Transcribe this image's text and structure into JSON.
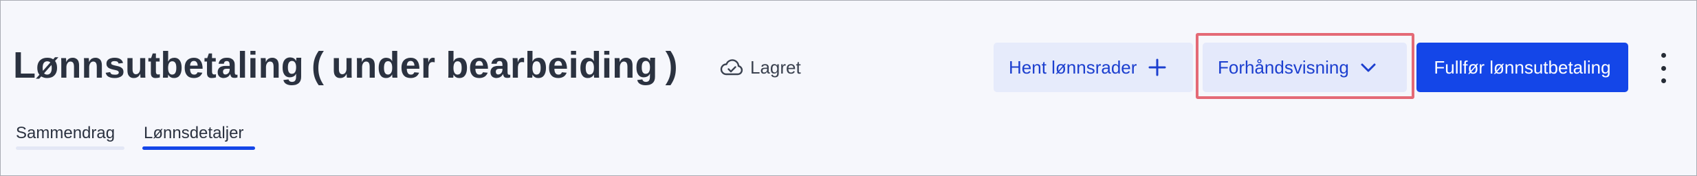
{
  "header": {
    "title": "Lønnsutbetaling ( under bearbeiding )",
    "save_status": "Lagret",
    "save_icon": "cloud-check-icon"
  },
  "actions": {
    "hent_label": "Hent lønnsrader",
    "hent_icon": "plus-icon",
    "preview_label": "Forhåndsvisning",
    "preview_icon": "chevron-down-icon",
    "complete_label": "Fullfør lønnsutbetaling",
    "more_icon": "kebab-menu-icon"
  },
  "tabs": [
    {
      "label": "Sammendrag",
      "active": false
    },
    {
      "label": "Lønnsdetaljer",
      "active": true
    }
  ],
  "colors": {
    "primary": "#1446e8",
    "secondary_bg": "#e6ebfb",
    "highlight_outline": "#e46a76",
    "page_bg": "#f6f7fc"
  }
}
